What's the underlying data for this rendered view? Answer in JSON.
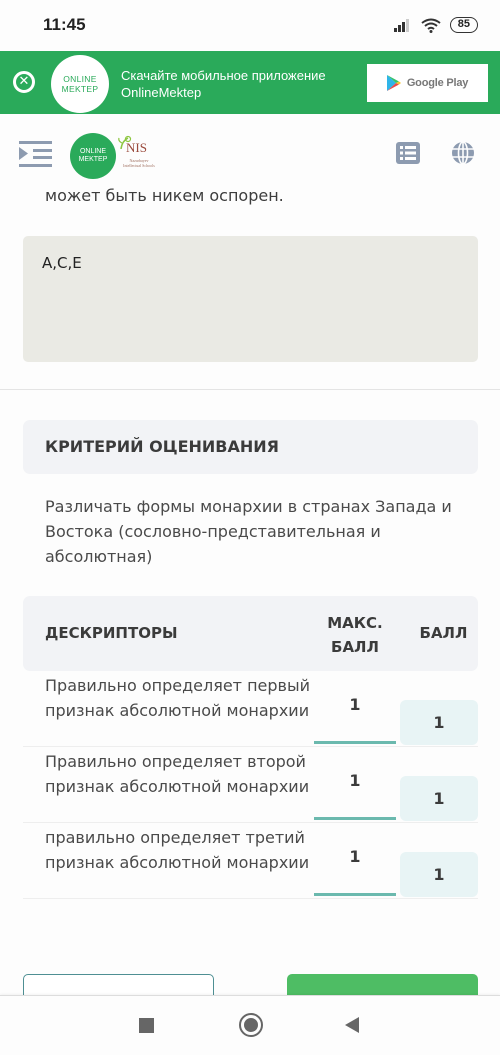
{
  "status_bar": {
    "time": "11:45",
    "battery": "85",
    "icons": [
      "signal-icon",
      "wifi-icon",
      "battery-icon"
    ]
  },
  "app_banner": {
    "logo_line1": "ONLINE",
    "logo_line2": "MEKTEP",
    "text_line1": "Скачайте мобильное приложение",
    "text_line2": "OnlineMektep",
    "store_button_label": "Google Play",
    "colors": {
      "background": "#2aaa5a"
    }
  },
  "header": {
    "logo_line1": "ONLINE",
    "logo_line2": "MEKTEP",
    "partner_logo": "NIS",
    "partner_sub": "Nazarbayev Intellectual Schools"
  },
  "question": {
    "text_tail": "может быть никем оспорен.",
    "answer": "A,C,E"
  },
  "criteria": {
    "header": "КРИТЕРИЙ ОЦЕНИВАНИЯ",
    "description": "Различать формы монархии в странах Запада и Востока (сословно-представительная и абсолютная)"
  },
  "descriptors_table": {
    "columns": {
      "descriptor": "ДЕСКРИПТОРЫ",
      "max_line1": "МАКС.",
      "max_line2": "БАЛЛ",
      "score": "БАЛЛ"
    },
    "rows": [
      {
        "descriptor": "Правильно определяет первый признак абсолютной монархии",
        "max": "1",
        "score": "1"
      },
      {
        "descriptor": "Правильно определяет второй признак абсолютной монархии",
        "max": "1",
        "score": "1"
      },
      {
        "descriptor": "правильно определяет третий признак абсолютной монархии",
        "max": "1",
        "score": "1"
      }
    ]
  },
  "colors": {
    "accent_green": "#4ebd64",
    "accent_teal": "#6bb9ae",
    "score_bg": "#e8f4f5"
  }
}
